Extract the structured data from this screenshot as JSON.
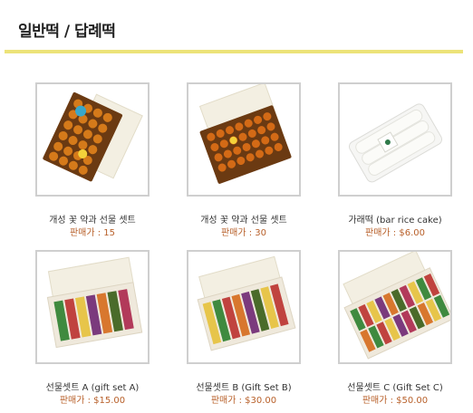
{
  "page": {
    "title": "일반떡 / 답례떡"
  },
  "products": [
    {
      "name": "개성 꽃 약과 선물 셋트",
      "price": "판매가 : 15",
      "image": "yakgwa-box-photo"
    },
    {
      "name": "개성 꽃 약과 선물 셋트",
      "price": "판매가 : 30",
      "image": "yakgwa-box-photo"
    },
    {
      "name": "가래떡 (bar rice cake)",
      "price": "판매가 : $6.00",
      "image": "garaetteok-tray-photo"
    },
    {
      "name": "선물셋트 A (gift set A)",
      "price": "판매가 : $15.00",
      "image": "tteok-gift-box-photo"
    },
    {
      "name": "선물셋트 B (Gift Set B)",
      "price": "판매가 : $30.00",
      "image": "tteok-gift-box-photo"
    },
    {
      "name": "선물셋트 C (Gift Set C)",
      "price": "판매가 : $50.00",
      "image": "tteok-gift-box-photo"
    }
  ]
}
